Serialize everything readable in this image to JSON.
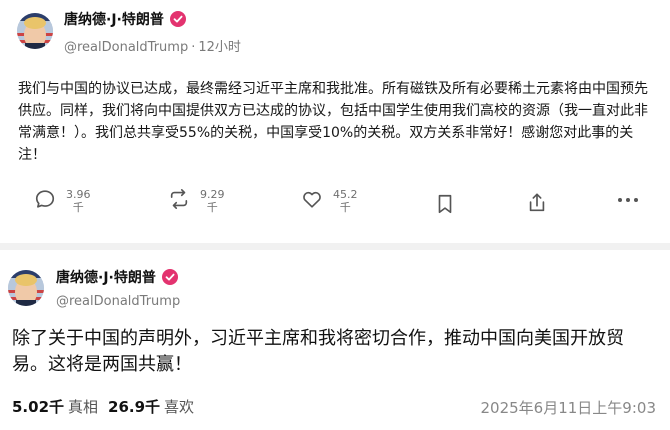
{
  "post1": {
    "author_name": "唐纳德·J·特朗普",
    "handle": "@realDonaldTrump",
    "time": "12小时",
    "text": "我们与中国的协议已达成，最终需经习近平主席和我批准。所有磁铁及所有必要稀土元素将由中国预先供应。同样，我们将向中国提供双方已达成的协议，包括中国学生使用我们高校的资源（我一直对此非常满意！）。我们总共享受55%的关税，中国享受10%的关税。双方关系非常好！感谢您对此事的关注！",
    "actions": {
      "reply": {
        "icon": "comment-icon",
        "value": "3.96",
        "unit": "千"
      },
      "repost": {
        "icon": "repost-icon",
        "value": "9.29",
        "unit": "千"
      },
      "like": {
        "icon": "heart-icon",
        "value": "45.2",
        "unit": "千"
      },
      "bookmark": {
        "icon": "bookmark-icon"
      },
      "share": {
        "icon": "share-icon"
      },
      "more": {
        "icon": "more-icon"
      }
    }
  },
  "post2": {
    "author_name": "唐纳德·J·特朗普",
    "handle": "@realDonaldTrump",
    "text": "除了关于中国的声明外，习近平主席和我将密切合作，推动中国向美国开放贸易。这将是两国共赢！",
    "stats": {
      "reposts_value": "5.02千",
      "reposts_label": "真相",
      "likes_value": "26.9千",
      "likes_label": "喜欢"
    },
    "timestamp": "2025年6月11日上午9:03"
  },
  "colors": {
    "verified": "#e3336f",
    "muted": "#7a7a7a",
    "icon": "#555555"
  }
}
